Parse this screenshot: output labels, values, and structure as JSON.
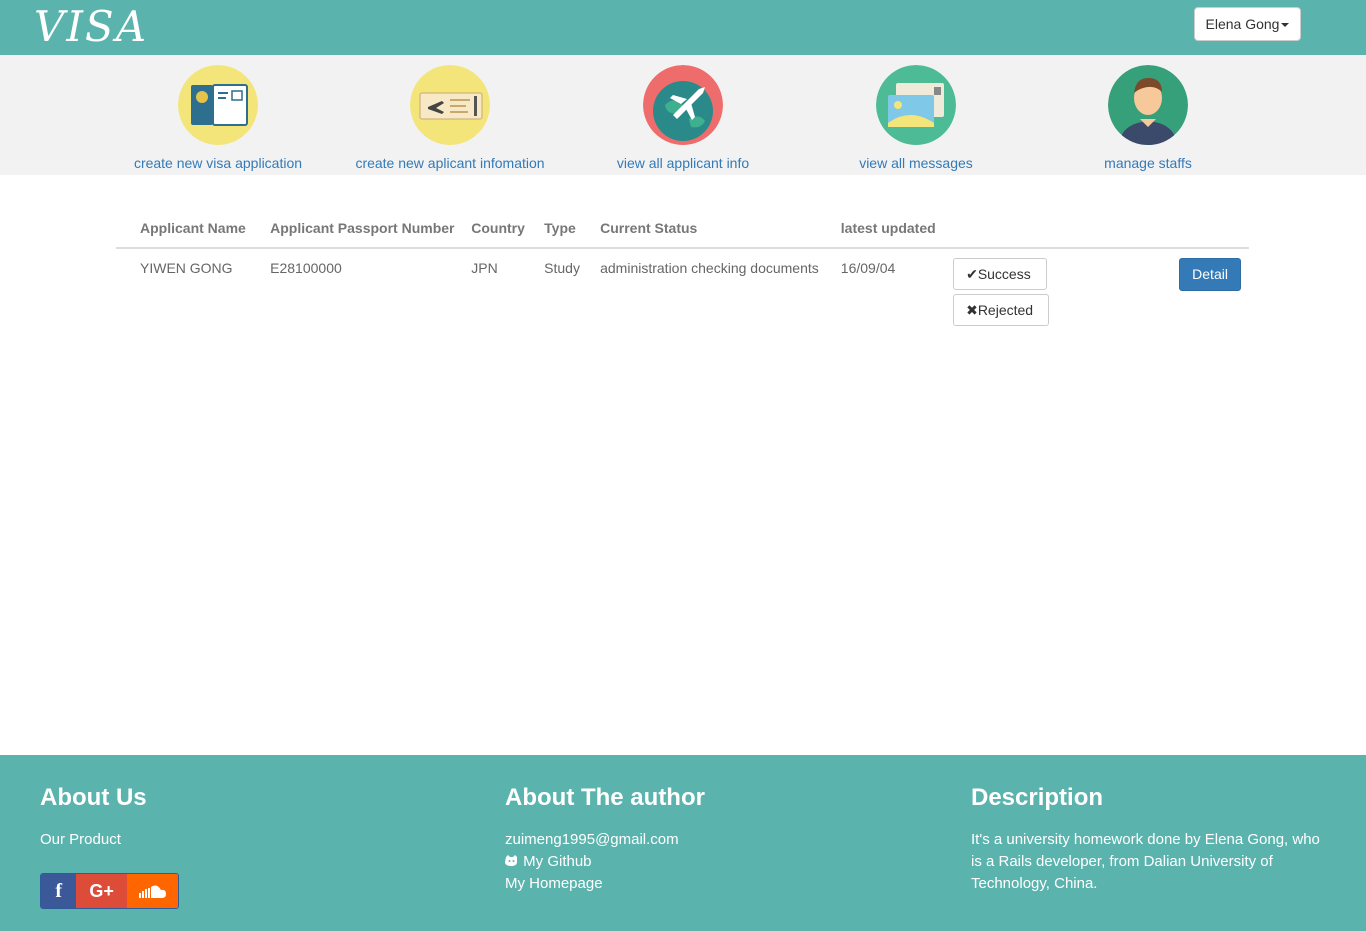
{
  "navbar": {
    "brand": "VISA",
    "user_menu_label": "Elena Gong"
  },
  "quick_actions": [
    {
      "label": "create new visa application",
      "icon": "passport-icon"
    },
    {
      "label": "create new aplicant infomation",
      "icon": "boarding-pass-icon"
    },
    {
      "label": "view all applicant info",
      "icon": "globe-airplane-icon"
    },
    {
      "label": "view all messages",
      "icon": "postcard-icon"
    },
    {
      "label": "manage staffs",
      "icon": "staff-avatar-icon"
    }
  ],
  "table": {
    "headers": [
      "Applicant Name",
      "Applicant Passport Number",
      "Country",
      "Type",
      "Current Status",
      "latest updated"
    ],
    "rows": [
      {
        "name": "YIWEN GONG",
        "passport": "E28100000",
        "country": "JPN",
        "type": "Study",
        "status": "administration checking documents",
        "updated": "16/09/04",
        "success_label": "Success",
        "rejected_label": "Rejected",
        "detail_label": "Detail"
      }
    ]
  },
  "footer": {
    "about_us": {
      "title": "About Us",
      "link": "Our Product"
    },
    "social": [
      "facebook-icon",
      "google-plus-icon",
      "soundcloud-icon"
    ],
    "author": {
      "title": "About The author",
      "email": "zuimeng1995@gmail.com",
      "github": "My Github",
      "homepage": "My Homepage"
    },
    "description": {
      "title": "Description",
      "text": "It's a university homework done by Elena Gong, who is a Rails developer, from Dalian University of Technology, China."
    }
  },
  "colors": {
    "teal": "#5bb3ad",
    "link_blue": "#337ab7",
    "strip_bg": "#f2f2f2"
  }
}
